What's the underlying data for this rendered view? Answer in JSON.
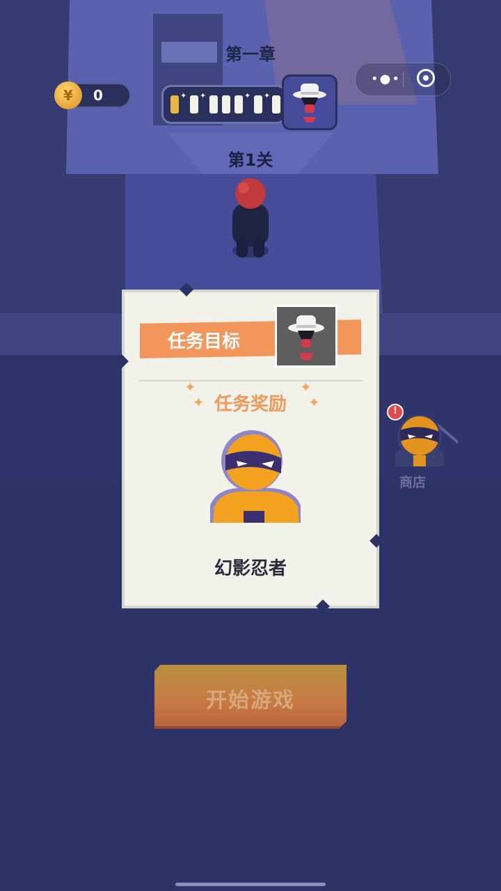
{
  "hud": {
    "coins": "0",
    "coin_symbol": "¥",
    "chapter_title": "第一章",
    "level_label": "第1关",
    "progress_segments_total": 8,
    "progress_segments_done": 1
  },
  "mission_card": {
    "target_label": "任务目标",
    "reward_label": "任务奖励",
    "reward_name": "幻影忍者"
  },
  "shop": {
    "label": "商店",
    "alert_mark": "!"
  },
  "start_button": {
    "label": "开始游戏"
  },
  "colors": {
    "background": "#2c3264",
    "banner": "#f2965c",
    "reward_title": "#f09a5a",
    "start_button": "#c87a44",
    "coin": "#e8a23a"
  }
}
